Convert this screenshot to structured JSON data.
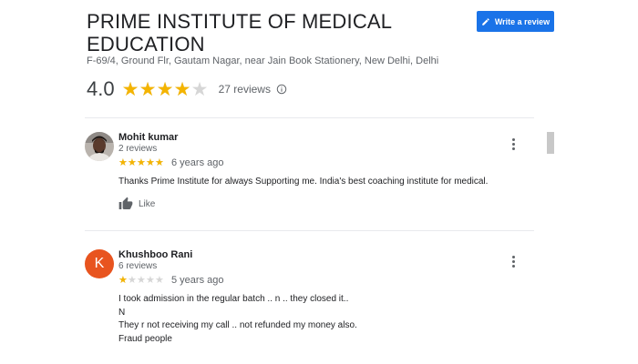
{
  "place": {
    "title": "PRIME INSTITUTE OF MEDICAL EDUCATION",
    "address": "F-69/4, Ground Flr, Gautam Nagar, near Jain Book Stationery, New Delhi, Delhi",
    "rating": "4.0",
    "rating_fraction": 0.8,
    "reviews_label": "27 reviews"
  },
  "actions": {
    "write_review_label": "Write a review",
    "write_review_icon": "pencil-icon"
  },
  "colors": {
    "star": "#f4b400",
    "star_empty": "#d6d6d6",
    "accent": "#1a73e8",
    "avatar_k": "#e8541f"
  },
  "reviews": [
    {
      "name": "Mohit kumar",
      "count": "2 reviews",
      "stars": 5,
      "time": "6 years ago",
      "lines": [
        "Thanks Prime Institute for always Supporting me. India's best coaching institute for medical."
      ],
      "like_label": "Like",
      "avatar": "photo"
    },
    {
      "name": "Khushboo Rani",
      "count": "6 reviews",
      "stars": 1,
      "time": "5 years ago",
      "avatar_letter": "K",
      "lines": [
        "I took admission in the regular batch .. n .. they closed it..",
        "N",
        "They r not receiving my call .. not refunded my money also.",
        "Fraud people"
      ]
    }
  ]
}
